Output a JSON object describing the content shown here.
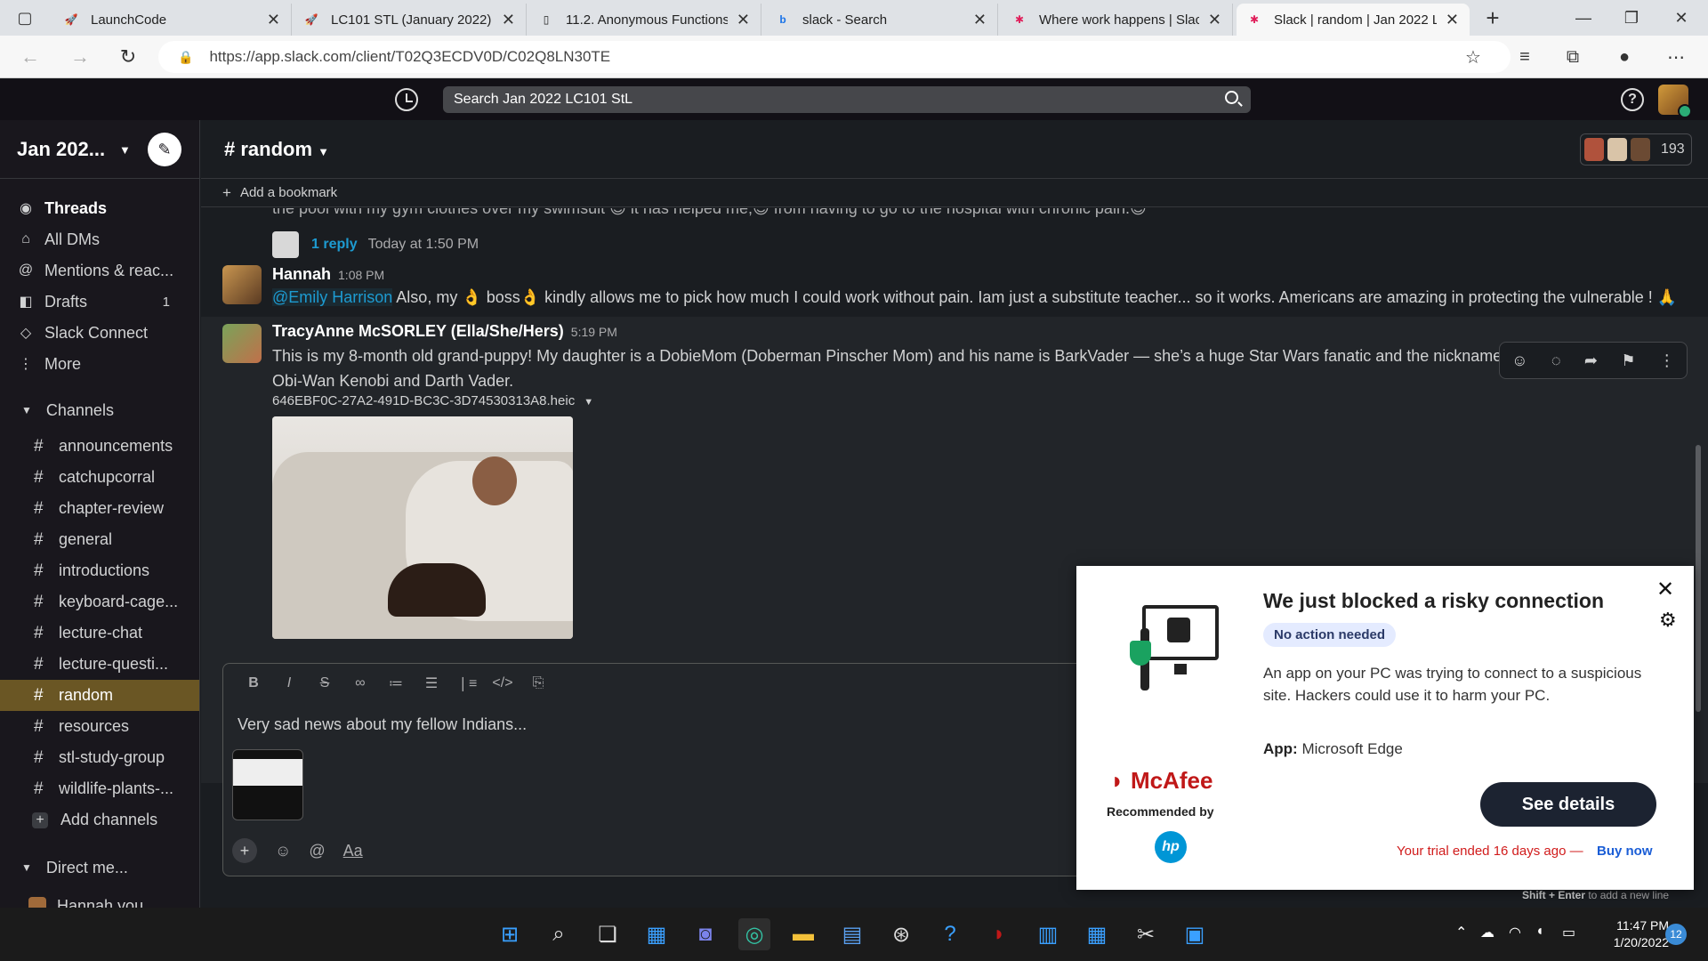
{
  "browser": {
    "tabs": [
      {
        "title": "LaunchCode",
        "icon": "launchcode-icon",
        "active": false
      },
      {
        "title": "LC101 STL (January 2022)",
        "icon": "launchcode-icon",
        "active": false
      },
      {
        "title": "11.2. Anonymous Functions",
        "icon": "page-icon",
        "active": false
      },
      {
        "title": "slack - Search",
        "icon": "bing-icon",
        "active": false
      },
      {
        "title": "Where work happens | Slack",
        "icon": "slack-icon",
        "active": false
      },
      {
        "title": "Slack | random | Jan 2022 LC101 StL",
        "icon": "slack-icon",
        "active": true
      }
    ],
    "url": "https://app.slack.com/client/T02Q3ECDV0D/C02Q8LN30TE"
  },
  "slack": {
    "search_placeholder": "Search Jan 2022 LC101 StL",
    "workspace": "Jan 202...",
    "nav": [
      {
        "label": "Threads",
        "icon": "threads-icon",
        "bold": true,
        "badge": ""
      },
      {
        "label": "All DMs",
        "icon": "dms-icon",
        "bold": false,
        "badge": ""
      },
      {
        "label": "Mentions & reac...",
        "icon": "at-icon",
        "bold": false,
        "badge": ""
      },
      {
        "label": "Drafts",
        "icon": "drafts-icon",
        "bold": false,
        "badge": "1"
      },
      {
        "label": "Slack Connect",
        "icon": "connect-icon",
        "bold": false,
        "badge": ""
      },
      {
        "label": "More",
        "icon": "more-icon",
        "bold": false,
        "badge": ""
      }
    ],
    "channels_header": "Channels",
    "channels": [
      "announcements",
      "catchupcorral",
      "chapter-review",
      "general",
      "introductions",
      "keyboard-cage...",
      "lecture-chat",
      "lecture-questi...",
      "random",
      "resources",
      "stl-study-group",
      "wildlife-plants-..."
    ],
    "active_channel": "random",
    "add_channels": "Add channels",
    "dm_header": "Direct me...",
    "dm_partial": "Hannah  you",
    "channel_title": "# random",
    "member_count": "193",
    "bookmark": "Add a bookmark",
    "cut_line": "the pool with my gym clothes over my swimsuit 😊 it has helped me,😊 from having to go to the hospital with chronic pain.😊",
    "thread": {
      "reply": "1 reply",
      "time": "Today at 1:50 PM"
    },
    "messages": [
      {
        "author": "Hannah",
        "time": "1:08 PM",
        "mention": "@Emily Harrison",
        "text": " Also, my 👌 boss👌  kindly allows me to pick how much I could work without pain. Iam just a substitute teacher... so it works. Americans are amazing in protecting the vulnerable ! 🙏"
      },
      {
        "author": "TracyAnne McSORLEY (Ella/She/Hers)",
        "time": "5:19 PM",
        "text": "This is my 8-month old grand-puppy! My daughter is a DobieMom (Doberman Pinscher Mom) and his name is BarkVader — she’s a huge Star Wars fanatic and the nicknames/names are a play on Obi-Wan Kenobi and Darth Vader.",
        "attachment": "646EBF0C-27A2-491D-BC3C-3D74530313A8.heic"
      }
    ],
    "composer_draft": "Very sad news about my fellow Indians...",
    "hint_bold": "Shift + Enter",
    "hint_rest": " to add a new line"
  },
  "mcafee": {
    "title": "We just blocked a risky connection",
    "pill": "No action needed",
    "body": "An app on your PC was trying to connect to a suspicious site. Hackers could use it to harm your PC.",
    "app_label": "App:",
    "app_value": " Microsoft Edge",
    "logo": "McAfee",
    "recommended": "Recommended by",
    "hp": "hp",
    "button": "See details",
    "trial": "Your trial ended 16 days ago —",
    "buy": "Buy now"
  },
  "taskbar": {
    "time": "11:47 PM",
    "date": "1/20/2022",
    "notifications": "12"
  }
}
